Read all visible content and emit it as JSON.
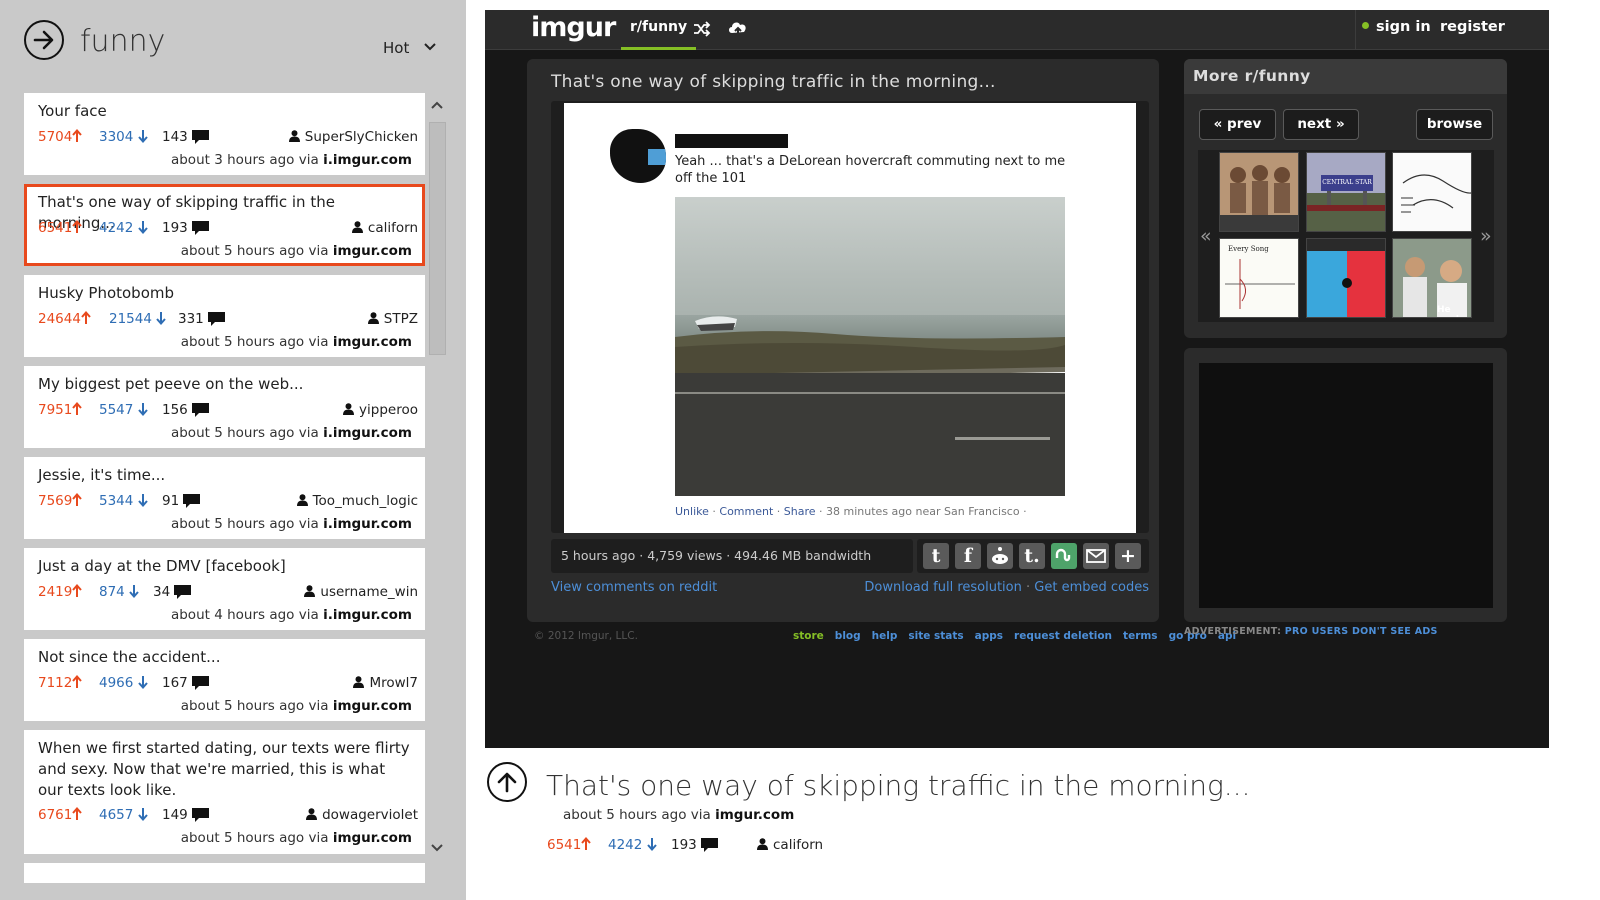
{
  "app": {
    "subreddit_title": "funny",
    "sort_label": "Hot"
  },
  "posts": [
    {
      "title": "Your face",
      "up": "5704",
      "down": "3304",
      "comments": "143",
      "user": "SuperSlyChicken",
      "time": "about 3 hours ago",
      "via": "via",
      "source": "i.imgur.com"
    },
    {
      "title": "That's one way of skipping traffic in the morning...",
      "up": "6541",
      "down": "4242",
      "comments": "193",
      "user": "californ",
      "time": "about 5 hours ago",
      "via": "via",
      "source": "imgur.com"
    },
    {
      "title": "Husky Photobomb",
      "up": "24644",
      "down": "21544",
      "comments": "331",
      "user": "STPZ",
      "time": "about 5 hours ago",
      "via": "via",
      "source": "imgur.com"
    },
    {
      "title": "My biggest pet peeve on the web...",
      "up": "7951",
      "down": "5547",
      "comments": "156",
      "user": "yipperoo",
      "time": "about 5 hours ago",
      "via": "via",
      "source": "i.imgur.com"
    },
    {
      "title": "Jessie, it's time...",
      "up": "7569",
      "down": "5344",
      "comments": "91",
      "user": "Too_much_logic",
      "time": "about 5 hours ago",
      "via": "via",
      "source": "i.imgur.com"
    },
    {
      "title": "Just a day at the DMV [facebook]",
      "up": "2419",
      "down": "874",
      "comments": "34",
      "user": "username_win",
      "time": "about 4 hours ago",
      "via": "via",
      "source": "i.imgur.com"
    },
    {
      "title": "Not since the accident...",
      "up": "7112",
      "down": "4966",
      "comments": "167",
      "user": "Mrowl7",
      "time": "about 5 hours ago",
      "via": "via",
      "source": "imgur.com"
    },
    {
      "title": "When we first started dating, our texts were flirty and sexy. Now that we're married, this is what our texts look like.",
      "up": "6761",
      "down": "4657",
      "comments": "149",
      "user": "dowagerviolet",
      "time": "about 5 hours ago",
      "via": "via",
      "source": "imgur.com"
    }
  ],
  "imgur": {
    "logo": "imgur",
    "tab": "r/funny",
    "sign_in": "sign in",
    "register": "register",
    "post_title": "That's one way of skipping traffic in the morning...",
    "fb_text": "Yeah ... that's a DeLorean hovercraft commuting next to me off the 101",
    "fb_unlike": "Unlike",
    "fb_comment": "Comment",
    "fb_share": "Share",
    "fb_meta": "· 38 minutes ago near San Francisco ·",
    "info": "5 hours ago · 4,759 views · 494.46 MB bandwidth",
    "view_comments": "View comments on reddit",
    "download": "Download full resolution",
    "embed": "Get embed codes",
    "copyright": "© 2012 Imgur, LLC.",
    "footer_links": [
      "store",
      "blog",
      "help",
      "site stats",
      "apps",
      "request deletion",
      "terms",
      "go pro",
      "api"
    ],
    "more_title": "More r/funny",
    "prev": "« prev",
    "next": "next »",
    "browse": "browse",
    "thumb_texts": [
      "CENTRAL STAR",
      "Every Song",
      "He mad"
    ],
    "ad_label": "ADVERTISEMENT:",
    "ad_pro": "PRO USERS DON'T SEE ADS",
    "share_icons": [
      "twitter-icon",
      "facebook-icon",
      "reddit-icon",
      "tumblr-icon",
      "stumbleupon-icon",
      "email-icon",
      "plus-icon"
    ]
  },
  "detail": {
    "title": "That's one way of skipping traffic in the morning...",
    "time": "about 5 hours ago",
    "via": "via",
    "source": "imgur.com",
    "up": "6541",
    "down": "4242",
    "comments": "193",
    "user": "californ"
  },
  "colors": {
    "upvote": "#e8491d",
    "downvote": "#2e6db4",
    "selection": "#e8491d",
    "imgur_green": "#85bf25",
    "link_blue": "#4d8fd8"
  }
}
